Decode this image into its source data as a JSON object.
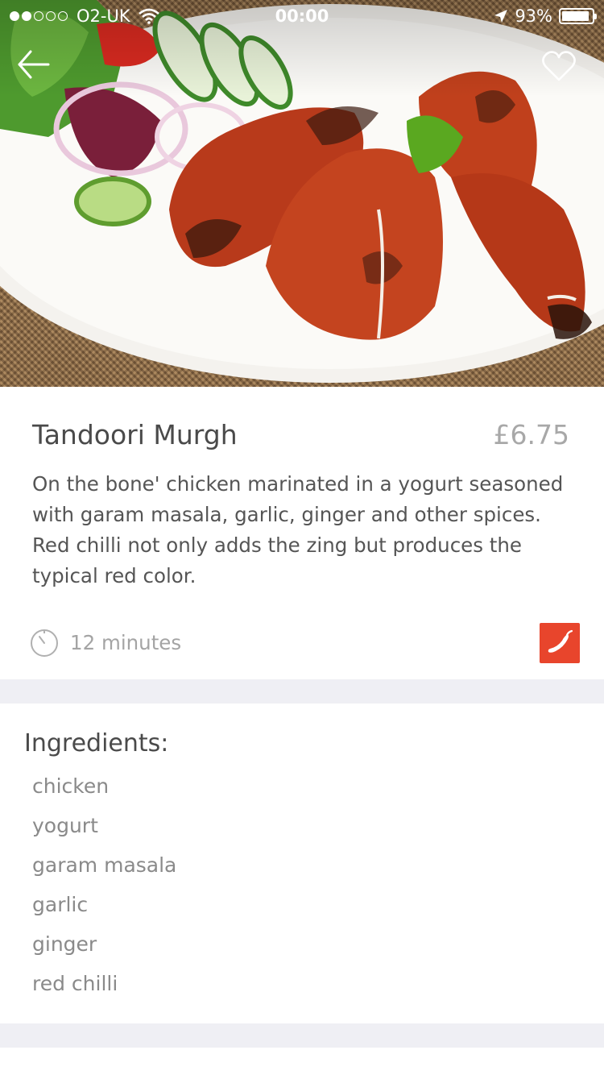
{
  "status_bar": {
    "carrier": "O2-UK",
    "time": "00:00",
    "battery": "93%",
    "battery_level": 0.93,
    "signal_bars_filled": 2,
    "signal_bars_total": 5
  },
  "header": {
    "back_icon": "back-arrow-icon",
    "favorite_icon": "heart-outline-icon"
  },
  "dish": {
    "name": "Tandoori Murgh",
    "price": "£6.75",
    "description": "On the bone' chicken marinated in a yogurt seasoned with garam masala, garlic, ginger and other spices. Red chilli not only adds the zing but produces the typical red color.",
    "prep_time": "12 minutes",
    "prep_icon": "timer-icon",
    "spicy_icon": "chilli-icon"
  },
  "ingredients": {
    "title": "Ingredients:",
    "items": [
      "chicken",
      "yogurt",
      "garam masala",
      "garlic",
      "ginger",
      "red chilli"
    ]
  },
  "colors": {
    "accent_red": "#e8452c",
    "separator": "#efeff4",
    "price_gray": "#a8a8a8"
  }
}
